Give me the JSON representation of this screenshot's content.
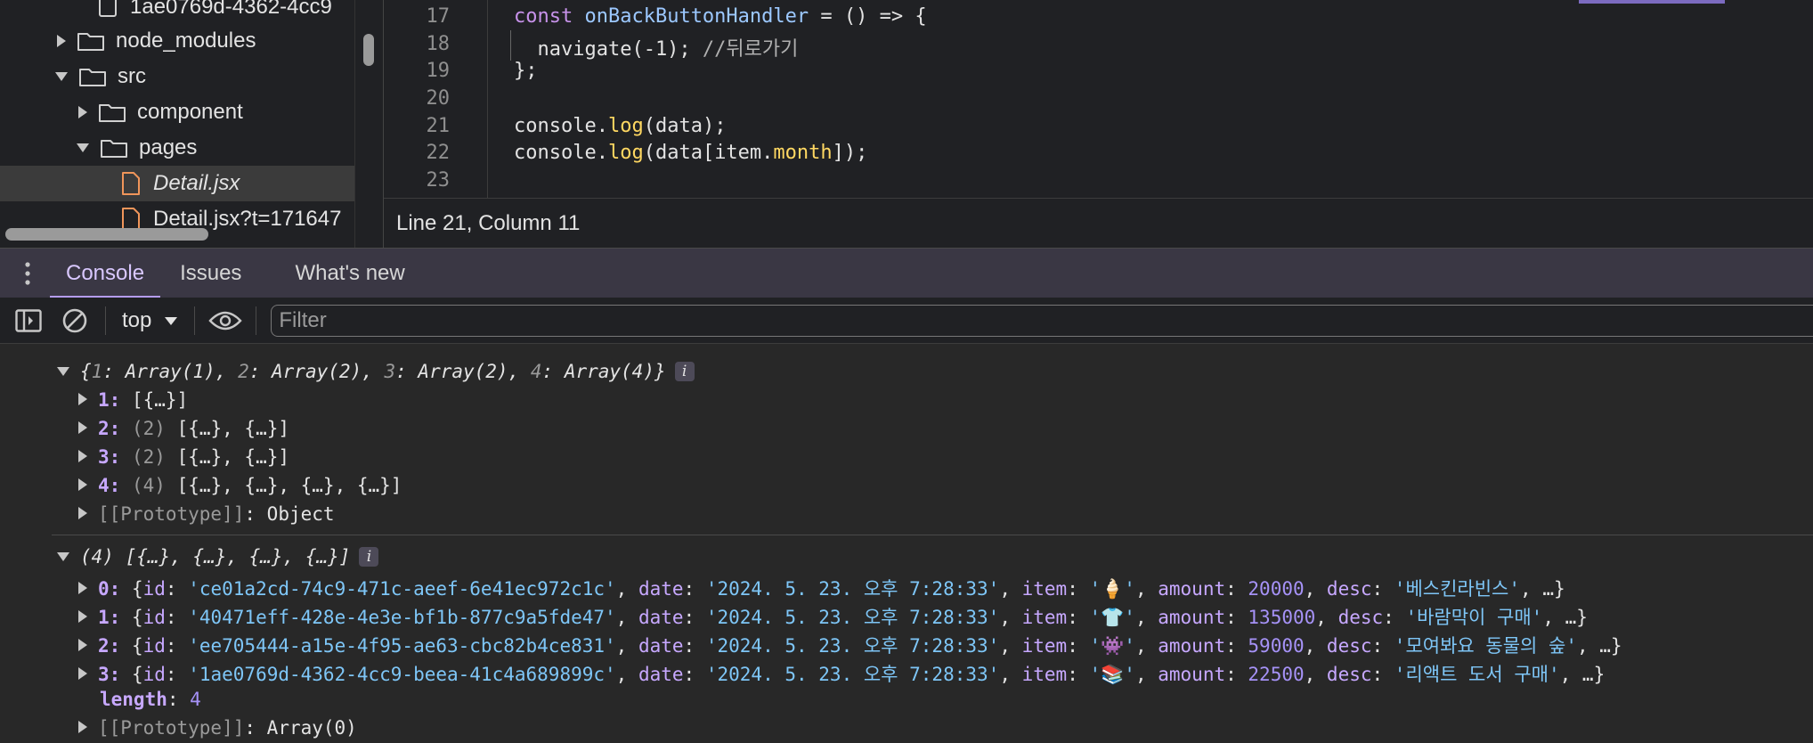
{
  "file_tree": {
    "items": [
      {
        "label": "1ae0769d-4362-4cc9",
        "type": "file-generic",
        "depth": 4
      },
      {
        "label": "node_modules",
        "type": "folder",
        "expanded": false,
        "depth": 3
      },
      {
        "label": "src",
        "type": "folder",
        "expanded": true,
        "depth": 3
      },
      {
        "label": "component",
        "type": "folder",
        "expanded": false,
        "depth": 4
      },
      {
        "label": "pages",
        "type": "folder",
        "expanded": true,
        "depth": 4
      },
      {
        "label": "Detail.jsx",
        "type": "file",
        "selected": true,
        "depth": 5
      },
      {
        "label": "Detail.jsx?t=171647",
        "type": "file",
        "depth": 5
      }
    ]
  },
  "editor": {
    "line_numbers": [
      "17",
      "18",
      "19",
      "20",
      "21",
      "22",
      "23"
    ],
    "status": "Line 21, Column 11"
  },
  "tabs": [
    {
      "label": "Console",
      "active": true
    },
    {
      "label": "Issues",
      "active": false
    },
    {
      "label": "What's new",
      "active": false
    }
  ],
  "toolbar": {
    "context": "top",
    "filter_placeholder": "Filter"
  },
  "console": {
    "obj1_summary_keys": [
      "1",
      "2",
      "3",
      "4"
    ],
    "obj1_summary_vals": [
      "Array(1)",
      "Array(2)",
      "Array(2)",
      "Array(4)"
    ],
    "obj1_rows": [
      {
        "key": "1",
        "count": "",
        "val": "[{…}]"
      },
      {
        "key": "2",
        "count": "(2)",
        "val": "[{…}, {…}]"
      },
      {
        "key": "3",
        "count": "(2)",
        "val": "[{…}, {…}]"
      },
      {
        "key": "4",
        "count": "(4)",
        "val": "[{…}, {…}, {…}, {…}]"
      }
    ],
    "obj1_proto": "Object",
    "arr_summary": "(4) [{…}, {…}, {…}, {…}]",
    "arr_rows": [
      {
        "idx": "0",
        "id": "ce01a2cd-74c9-471c-aeef-6e41ec972c1c",
        "date": "2024. 5. 23. 오후 7:28:33",
        "item": "🍦",
        "amount": "20000",
        "desc": "베스킨라빈스"
      },
      {
        "idx": "1",
        "id": "40471eff-428e-4e3e-bf1b-877c9a5fde47",
        "date": "2024. 5. 23. 오후 7:28:33",
        "item": "👕",
        "amount": "135000",
        "desc": "바람막이 구매"
      },
      {
        "idx": "2",
        "id": "ee705444-a15e-4f95-ae63-cbc82b4ce831",
        "date": "2024. 5. 23. 오후 7:28:33",
        "item": "👾",
        "amount": "59000",
        "desc": "모여봐요 동물의 숲"
      },
      {
        "idx": "3",
        "id": "1ae0769d-4362-4cc9-beea-41c4a689899c",
        "date": "2024. 5. 23. 오후 7:28:33",
        "item": "📚",
        "amount": "22500",
        "desc": "리액트 도서 구매"
      }
    ],
    "length_key": "length",
    "length_val": "4",
    "arr_proto": "Array(0)"
  },
  "colors": {
    "accent": "#b59cf5",
    "string": "#7ec6f7",
    "number": "#a692f7",
    "keyword": "#c792ea",
    "property_highlight": "#ffd862"
  },
  "icons": [
    "kebab-menu-icon",
    "sidebar-toggle-icon",
    "clear-console-icon",
    "dropdown-caret-icon",
    "eye-icon",
    "folder-icon",
    "file-icon",
    "expand-arrow-icon",
    "collapse-arrow-icon",
    "info-icon"
  ]
}
